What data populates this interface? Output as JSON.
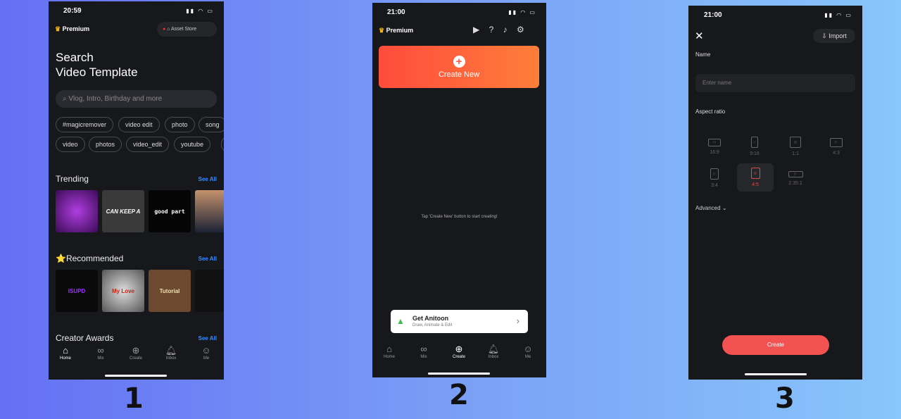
{
  "screen1": {
    "time": "20:59",
    "premium": "Premium",
    "asset_store": "Asset Store",
    "title_line1": "Search",
    "title_line2": "Video Template",
    "search_placeholder": "Vlog, Intro, Birthday and more",
    "tags_row1": [
      "#magicremover",
      "video edit",
      "photo",
      "song"
    ],
    "tags_row2": [
      "video",
      "photos",
      "video_edit",
      "youtube"
    ],
    "trending": "Trending",
    "recommended": "⭐Recommended",
    "creator_awards": "Creator Awards",
    "see_all": "See All",
    "trending_thumbs": [
      "",
      "CAN KEEP A",
      "good part",
      ""
    ],
    "recommended_thumbs": [
      "ISUPD",
      "My Love",
      "Tutorial",
      ""
    ],
    "nav": [
      "Home",
      "Mix",
      "Create",
      "Inbox",
      "Me"
    ],
    "active_nav": "Home"
  },
  "screen2": {
    "time": "21:00",
    "premium": "Premium",
    "create_new": "Create New",
    "empty_hint": "Tap 'Create New' button to start creating!",
    "promo_title": "Get Anitoon",
    "promo_subtitle": "Draw, Animate & Edit",
    "nav": [
      "Home",
      "Mix",
      "Create",
      "Inbox",
      "Me"
    ],
    "active_nav": "Create"
  },
  "screen3": {
    "time": "21:00",
    "import": "Import",
    "name_label": "Name",
    "name_placeholder": "Enter name",
    "aspect_label": "Aspect ratio",
    "ratios": [
      "16:9",
      "9:16",
      "1:1",
      "4:3",
      "3:4",
      "4:5",
      "2.35:1"
    ],
    "selected_ratio": "4:5",
    "advanced": "Advanced",
    "create": "Create"
  },
  "labels": [
    "1",
    "2",
    "3"
  ],
  "colors": {
    "accent_orange": "#ff5a3c",
    "see_all": "#3d8bff",
    "create_button": "#f25252",
    "selected_ratio": "#e04a4a"
  }
}
